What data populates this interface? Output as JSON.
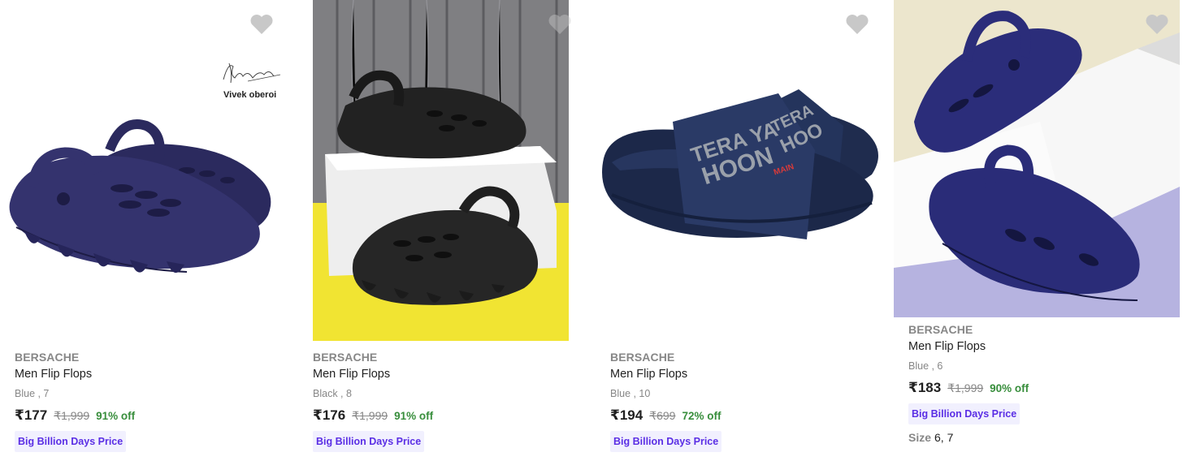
{
  "colors": {
    "price_green": "#388e3c",
    "badge_bg": "#f1f0fe",
    "badge_text": "#5a2ee5",
    "heart": "#c8c8c8"
  },
  "products": [
    {
      "brand": "BERSACHE",
      "title": "Men Flip Flops",
      "variant": "Blue , 7",
      "price": "₹177",
      "mrp": "₹1,999",
      "discount": "91% off",
      "badge": "Big Billion Days Price",
      "endorser": "Vivek oberoi",
      "icon": "heart-icon"
    },
    {
      "brand": "BERSACHE",
      "title": "Men Flip Flops",
      "variant": "Black , 8",
      "price": "₹176",
      "mrp": "₹1,999",
      "discount": "91% off",
      "badge": "Big Billion Days Price",
      "icon": "heart-icon"
    },
    {
      "brand": "BERSACHE",
      "title": "Men Flip Flops",
      "variant": "Blue , 10",
      "price": "₹194",
      "mrp": "₹699",
      "discount": "72% off",
      "badge": "Big Billion Days Price",
      "slide_print": [
        "TERA YA",
        "HOON",
        "MAIN"
      ],
      "icon": "heart-icon"
    },
    {
      "brand": "BERSACHE",
      "title": "Men Flip Flops",
      "variant": "Blue , 6",
      "price": "₹183",
      "mrp": "₹1,999",
      "discount": "90% off",
      "badge": "Big Billion Days Price",
      "sizes_label": "Size",
      "sizes_value": "6, 7",
      "icon": "heart-icon"
    }
  ]
}
